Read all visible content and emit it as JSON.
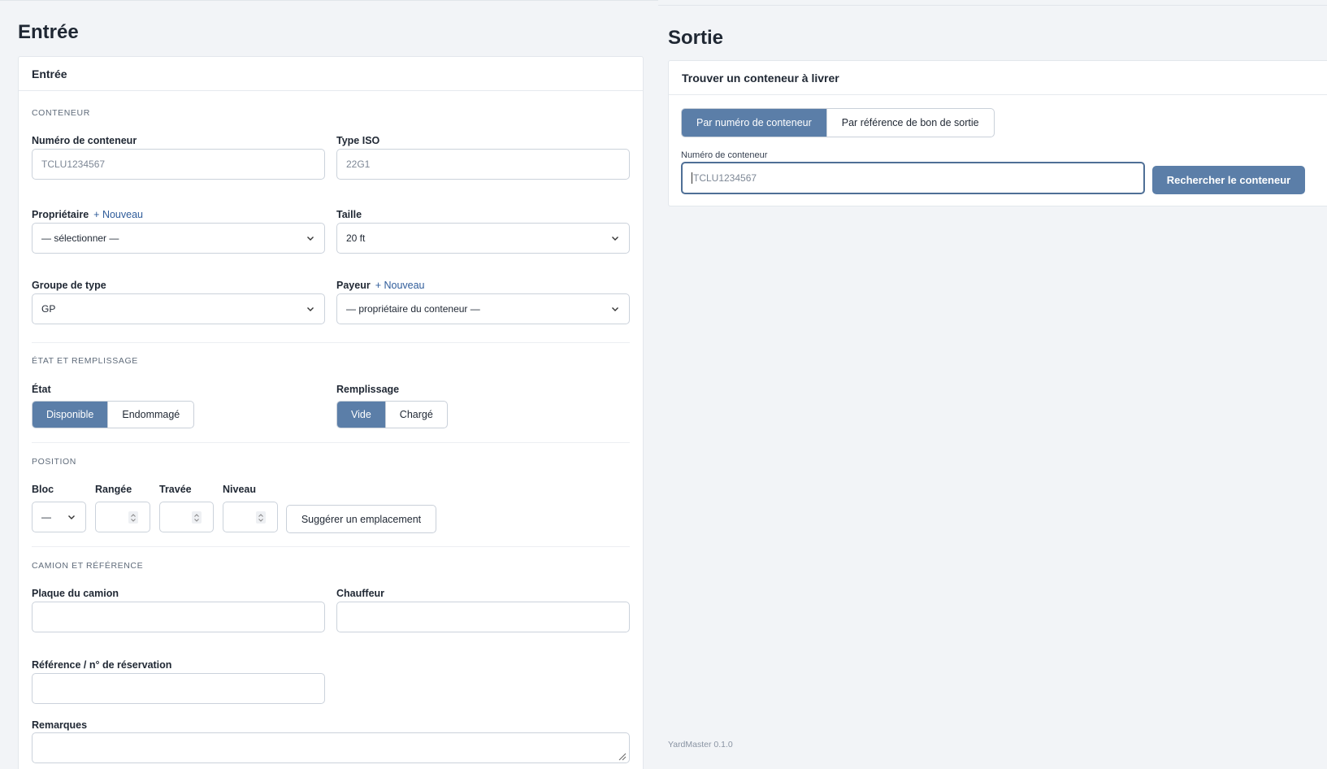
{
  "entree": {
    "page_title": "Entrée",
    "card_title": "Entrée",
    "sections": {
      "conteneur": "CONTENEUR",
      "etat": "ÉTAT ET REMPLISSAGE",
      "position": "POSITION",
      "camion": "CAMION ET RÉFÉRENCE"
    },
    "fields": {
      "numero_label": "Numéro de conteneur",
      "numero_placeholder": "TCLU1234567",
      "iso_label": "Type ISO",
      "iso_placeholder": "22G1",
      "proprietaire_label": "Propriétaire",
      "proprietaire_add": "+ Nouveau",
      "proprietaire_value": "— sélectionner —",
      "taille_label": "Taille",
      "taille_value": "20 ft",
      "groupe_label": "Groupe de type",
      "groupe_value": "GP",
      "payeur_label": "Payeur",
      "payeur_add": "+ Nouveau",
      "payeur_value": "— propriétaire du conteneur —",
      "etat_label": "État",
      "etat_options": [
        "Disponible",
        "Endommagé"
      ],
      "etat_selected": "Disponible",
      "remplissage_label": "Remplissage",
      "remplissage_options": [
        "Vide",
        "Chargé"
      ],
      "remplissage_selected": "Vide",
      "bloc_label": "Bloc",
      "bloc_value": "—",
      "rangee_label": "Rangée",
      "travee_label": "Travée",
      "niveau_label": "Niveau",
      "suggest_button": "Suggérer un emplacement",
      "plaque_label": "Plaque du camion",
      "chauffeur_label": "Chauffeur",
      "reference_label": "Référence / n° de réservation",
      "remarques_label": "Remarques"
    }
  },
  "sortie": {
    "page_title": "Sortie",
    "card_title": "Trouver un conteneur à livrer",
    "tabs": [
      "Par numéro de conteneur",
      "Par référence de bon de sortie"
    ],
    "active_tab": "Par numéro de conteneur",
    "numero_label": "Numéro de conteneur",
    "numero_placeholder": "TCLU1234567",
    "search_button": "Rechercher le conteneur"
  },
  "footer": {
    "version": "YardMaster 0.1.0"
  },
  "colors": {
    "accent": "#5b7ea8",
    "link": "#2f5c9a",
    "background": "#f2f4f7"
  }
}
